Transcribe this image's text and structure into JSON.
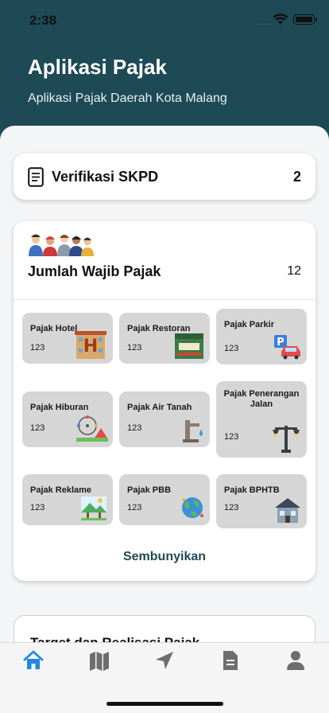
{
  "status_bar": {
    "time": "2:38",
    "dots": "·····"
  },
  "header": {
    "title": "Aplikasi Pajak",
    "subtitle": "Aplikasi Pajak Daerah Kota Malang"
  },
  "skpd": {
    "label": "Verifikasi SKPD",
    "count": "2",
    "icon": "document-icon"
  },
  "wajib_pajak": {
    "title": "Jumlah Wajib Pajak",
    "count": "12",
    "icon": "people-group-icon",
    "tiles": [
      {
        "name": "Pajak Hotel",
        "value": "123",
        "icon": "hotel-icon"
      },
      {
        "name": "Pajak Restoran",
        "value": "123",
        "icon": "restaurant-icon"
      },
      {
        "name": "Pajak Parkir",
        "value": "123",
        "icon": "parking-icon"
      },
      {
        "name": "Pajak Hiburan",
        "value": "123",
        "icon": "amusement-park-icon"
      },
      {
        "name": "Pajak Air Tanah",
        "value": "123",
        "icon": "water-pump-icon"
      },
      {
        "name": "Pajak Penerangan Jalan",
        "value": "123",
        "icon": "street-light-icon"
      },
      {
        "name": "Pajak Reklame",
        "value": "123",
        "icon": "billboard-icon"
      },
      {
        "name": "Pajak PBB",
        "value": "123",
        "icon": "globe-icon"
      },
      {
        "name": "Pajak BPHTB",
        "value": "123",
        "icon": "house-icon"
      }
    ],
    "hide_label": "Sembunyikan"
  },
  "target": {
    "title": "Target dan Realisasi Pajak"
  },
  "tabs": [
    {
      "icon": "home-icon",
      "active": true
    },
    {
      "icon": "map-icon",
      "active": false
    },
    {
      "icon": "navigation-icon",
      "active": false
    },
    {
      "icon": "file-icon",
      "active": false
    },
    {
      "icon": "user-icon",
      "active": false
    }
  ],
  "colors": {
    "header_bg": "#1e4a56",
    "accent": "#1e88e5",
    "tile_bg": "#d6d6d6",
    "tab_inactive": "#6e6e6e"
  }
}
